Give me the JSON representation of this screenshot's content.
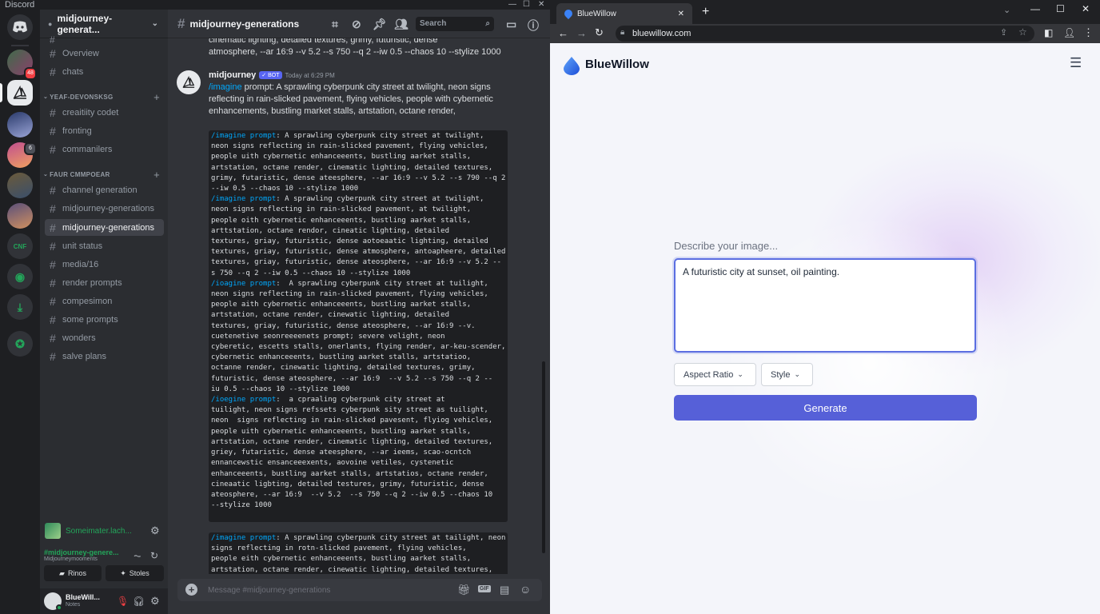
{
  "discord": {
    "window_title": "Discord",
    "server_name": "midjourney-generat...",
    "channels_top": [
      "Overview",
      "chats"
    ],
    "category1": "YEAF-DEVONSKSG",
    "category1_channels": [
      "creaitiity codet",
      "fronting",
      "commanilers"
    ],
    "category2": "FAUR CMMPOEAR",
    "category2_channels": [
      "channel generation",
      "midjourney-generations",
      "midjourney-generations",
      "unit status",
      "media/16",
      "render prompts",
      "compesimon",
      "some prompts",
      "wonders",
      "salve plans"
    ],
    "server_badge_1": "48",
    "server_badge_2": "6",
    "server_cnf_label": "CNF",
    "voice_user": "Someimater.lach...",
    "rtc_channel": "#midjourney-genere...",
    "rtc_subtitle": "Midjourneymooments",
    "rtc_btn_1": "Rinos",
    "rtc_btn_2": "Stoles",
    "user_name": "BlueWill...",
    "user_status": "Notes",
    "channel_title": "midjourney-generations",
    "search_placeholder": "Search",
    "top_cut_text_1": "cinematic lighting, detailed textures, grimy, futuristic, dense",
    "top_cut_text_2": "atmosphere, --ar 16:9 --v 5.2 --s 750 --q 2 --iw 0.5 --chaos 10 --stylize 1000",
    "msg_author": "midjourney",
    "msg_bot_tag": "✓ BOT",
    "msg_time": "Today at 6:29 PM",
    "msg_cmd": "/imagine",
    "msg_text": " prompt: A sprawling cyberpunk city street at twilight, neon signs reflecting in rain-slicked pavement, flying vehicles, people with cybernetic enhancements, bustling market stalls, artstation, octane render,",
    "code_block_1": [
      {
        "cmd": "/imagine prompt",
        "text": ": A sprawling cyberpunk city street at twilight,"
      },
      {
        "text": "neon signs reflecting in rain-slicked pavement, flying vehicles,"
      },
      {
        "text": "people uith cybernetic enhanceeents, bustling aarket stalls,"
      },
      {
        "text": "artstation, octane render, cinematic lighting, detailed textures,"
      },
      {
        "text": "grimy, futaristic, dense ateesphere, --ar 16:9 --v 5.2 --s 790 --q 2"
      },
      {
        "text": "--iw 0.5 --chaos 10 --stylize 1000"
      },
      {
        "cmd": "/imagine prompt",
        "text": ": A sprawling cyberpunk city street at twilight,"
      },
      {
        "text": "neon signs reflecting in rain-slicked pavement, at twilight,"
      },
      {
        "text": "people oith cybernetic enhanceeents, bustling aarket stalls,"
      },
      {
        "text": "arttstation, octane rendor, cineatic lighting, detailed"
      },
      {
        "text": "textures, griay, futuristic, dense aotoeaatic lighting, detailed"
      },
      {
        "text": "textures, griay, futuristic, dense atmosphere, antoapheere, detailed"
      },
      {
        "text": "textures, griay, futuristic, dense ateosphere, --ar 16:9 --v 5.2 --"
      },
      {
        "text": "s 750 --q 2 --iw 0.5 --chaos 10 --stylize 1000"
      },
      {
        "cmd": "/ioagine prompt",
        "text": ":  A sprawling cyberpunk city street at tuilight,"
      },
      {
        "text": "neon signs reflecting in rain-slicked pavement, flying vehicles,"
      },
      {
        "text": "people aith cybernetic enhanceeents, bustling aarket stalls,"
      },
      {
        "text": "artstation, octane render, cinewatic lighting, detailed"
      },
      {
        "text": "textures, griay, futuristic, dense ateosphere, --ar 16:9 --v."
      },
      {
        "text": "cuetenetive seonreeeenets prompt; severe velight, neon"
      },
      {
        "text": "cyberetic, escetts stalls, onerlants, flying render, ar-keu-scender,"
      },
      {
        "text": "cybernetic enhanceeents, bustling aarket stalls, artstatioo,"
      },
      {
        "text": "octanne render, cinewatic lighting, detailed textures, grimy,"
      },
      {
        "text": "futuristic, dense ateosphere, --ar 16:9  --v 5.2 --s 750 --q 2 --"
      },
      {
        "text": "iu 0.5 --chaos 10 --stylize 1000"
      },
      {
        "cmd": "/ioegine prompt",
        "text": ":  a cpraaling cyberpunk city street at"
      },
      {
        "text": "tuilight, neon signs refssets cyberpunk sity street as tuilight,"
      },
      {
        "text": "neon  signs reflecting in rain-slicked pavesent, flyiog vehicles,"
      },
      {
        "text": "people uith cybernetic enhanceeents, bustling aarket stalls,"
      },
      {
        "text": "artstation, octane render, cinematic lighting, detailed textures,"
      },
      {
        "text": "griey, futaristic, dense ateesphere, --ar ieems, scao-ocntch"
      },
      {
        "text": "ennancewstic ensanceeexents, aovoine vetiles, cystenetic"
      },
      {
        "text": "enhanceeents, bustling aarket stalls, artstatios, octane render,"
      },
      {
        "text": "cineaatic ligbting, detailed testures, grimy, futuristic, dense"
      },
      {
        "text": "ateosphere, --ar 16:9  --v 5.2  --s 750 --q 2 --iw 0.5 --chaos 10"
      },
      {
        "text": "--stylize 1000"
      }
    ],
    "code_block_2": [
      {
        "cmd": "/imagine prompt",
        "text": ": A sprawling cyberpunk city street at tailight, neon"
      },
      {
        "text": "signs reflecting in rotn-slicked pavement, flying vehicles,"
      },
      {
        "text": "people eith cybernetic enhanceeents, bustling aarket stalls,"
      },
      {
        "text": "artstation, octane render, cinewatic lighting, detailed textures,"
      }
    ],
    "composer_placeholder": "Message #midjourney-generations"
  },
  "browser": {
    "tab_title": "BlueWillow",
    "url": "bluewillow.com"
  },
  "bluewillow": {
    "brand": "BlueWillow",
    "prompt_label": "Describe your image...",
    "prompt_value": "A futuristic city at sunset, oil painting.",
    "aspect_ratio_label": "Aspect Ratio",
    "style_label": "Style",
    "generate_label": "Generate",
    "brand_color": "#5660d8"
  }
}
